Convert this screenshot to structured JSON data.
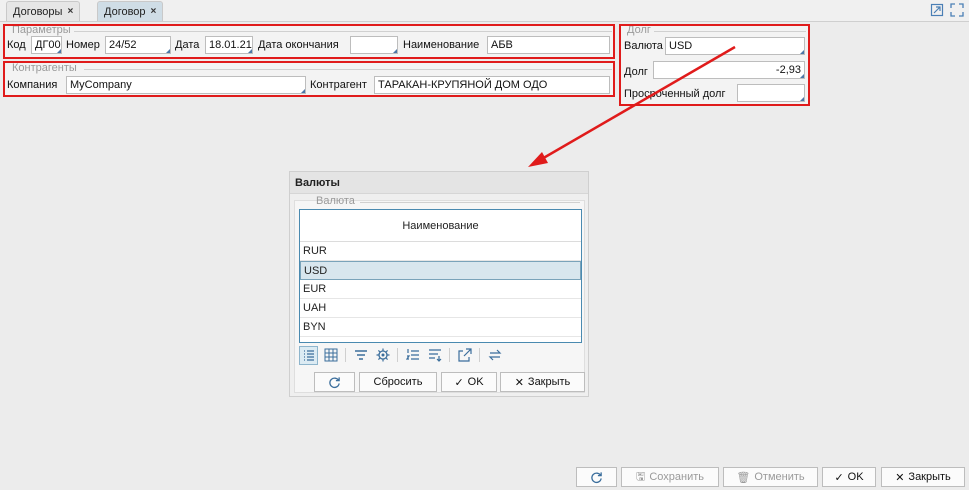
{
  "tabs": [
    {
      "label": "Договоры",
      "close": "×"
    },
    {
      "label": "Договор",
      "close": "×"
    }
  ],
  "params": {
    "title": "Параметры",
    "code_label": "Код",
    "code_value": "ДГ00",
    "number_label": "Номер",
    "number_value": "24/52",
    "date_label": "Дата",
    "date_value": "18.01.21",
    "end_date_label": "Дата окончания",
    "end_date_value": "",
    "name_label": "Наименование",
    "name_value": "АБВ"
  },
  "counterparties": {
    "title": "Контрагенты",
    "company_label": "Компания",
    "company_value": "MyCompany",
    "counterparty_label": "Контрагент",
    "counterparty_value": "ТАРАКАН-КРУПЯНОЙ ДОМ ОДО"
  },
  "debt": {
    "title": "Долг",
    "currency_label": "Валюта",
    "currency_value": "USD",
    "debt_label": "Долг",
    "debt_value": "-2,93",
    "overdue_label": "Просроченный долг",
    "overdue_value": ""
  },
  "dialog": {
    "title": "Валюты",
    "group_title": "Валюта",
    "column_header": "Наименование",
    "rows": [
      "RUR",
      "USD",
      "EUR",
      "UAH",
      "BYN"
    ],
    "selected": "USD",
    "buttons": {
      "reset": "Сбросить",
      "ok": "OK",
      "close": "Закрыть"
    }
  },
  "footer": {
    "save": "Сохранить",
    "cancel": "Отменить",
    "ok": "OK",
    "close": "Закрыть"
  },
  "colors": {
    "highlight": "#e01b1b",
    "accent": "#4a8ab0",
    "selected_row": "#d8e6ee"
  }
}
